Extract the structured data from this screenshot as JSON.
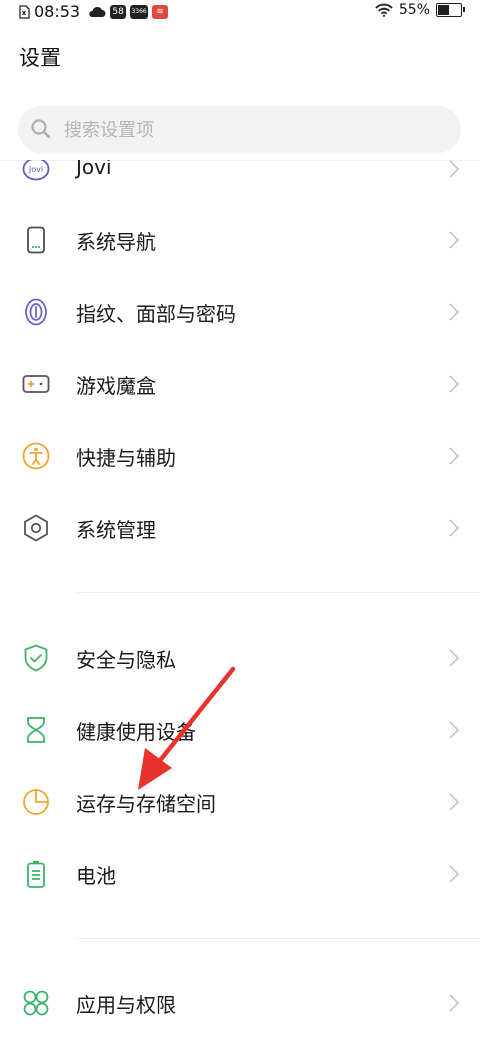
{
  "status_bar": {
    "time": "08:53",
    "mini_icons": [
      "58",
      "3366",
      "≋"
    ],
    "battery_percent": "55%",
    "battery_level": 0.55
  },
  "header": {
    "title": "设置"
  },
  "search": {
    "placeholder": "搜索设置项",
    "value": ""
  },
  "colors": {
    "accent_green": "#3fb36a",
    "accent_orange": "#f0a530",
    "icon_gray": "#555555",
    "icon_purple": "#6a64c8",
    "arrow_red": "#e8322c"
  },
  "groups": [
    {
      "items": [
        {
          "label": "Jovi",
          "icon": "jovi-icon"
        },
        {
          "label": "系统导航",
          "icon": "phone-navigation-icon"
        },
        {
          "label": "指纹、面部与密码",
          "icon": "fingerprint-icon"
        },
        {
          "label": "游戏魔盒",
          "icon": "gamepad-icon"
        },
        {
          "label": "快捷与辅助",
          "icon": "accessibility-icon"
        },
        {
          "label": "系统管理",
          "icon": "system-management-icon"
        }
      ]
    },
    {
      "items": [
        {
          "label": "安全与隐私",
          "icon": "shield-check-icon"
        },
        {
          "label": "健康使用设备",
          "icon": "hourglass-icon"
        },
        {
          "label": "运存与存储空间",
          "icon": "storage-pie-icon"
        },
        {
          "label": "电池",
          "icon": "battery-icon"
        }
      ]
    },
    {
      "items": [
        {
          "label": "应用与权限",
          "icon": "apps-grid-icon"
        }
      ]
    }
  ]
}
